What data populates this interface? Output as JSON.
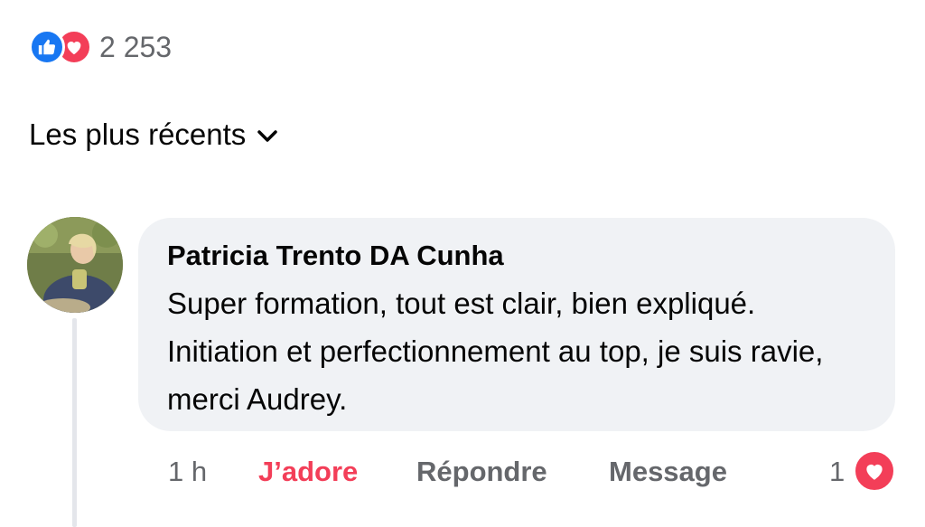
{
  "reactions": {
    "count": "2 253",
    "icons": [
      "like-icon",
      "love-icon"
    ]
  },
  "sort": {
    "label": "Les plus récents"
  },
  "comment": {
    "author": "Patricia Trento DA Cunha",
    "text": "Super formation, tout est clair, bien expliqué. Initiation et perfectionnement au top, je suis ravie, merci Audrey.",
    "time": "1 h",
    "reaction_label": "J’adore",
    "reply_label": "Répondre",
    "message_label": "Message",
    "reaction_count": "1"
  },
  "colors": {
    "like": "#1877f2",
    "love": "#f33e58",
    "bubble": "#f0f2f5",
    "secondary_text": "#65676b"
  }
}
